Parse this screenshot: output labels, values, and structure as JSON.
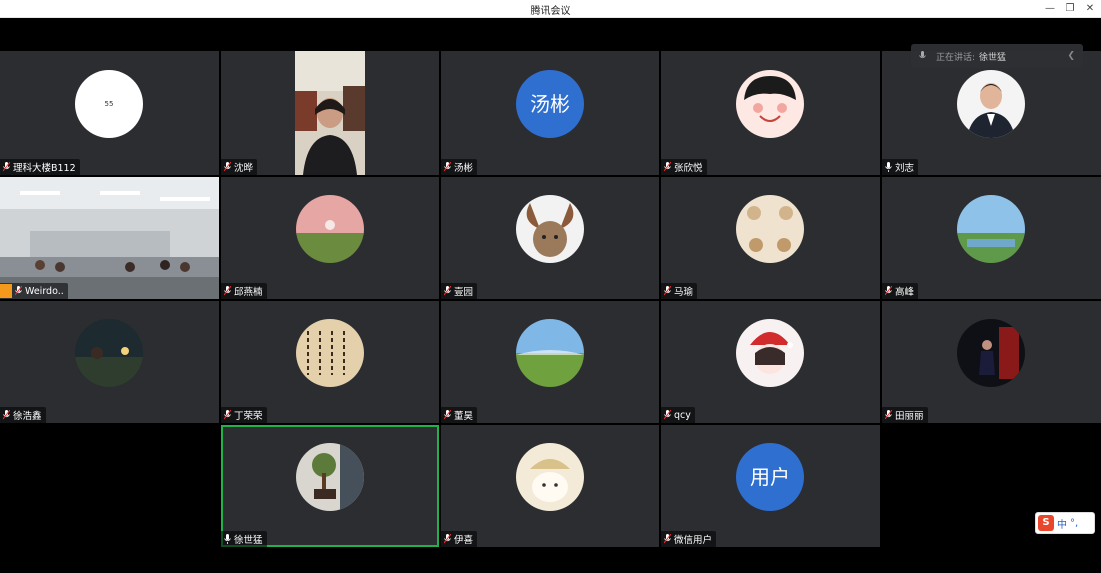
{
  "window": {
    "title": "腾讯会议",
    "controls": {
      "minimize": "—",
      "restore": "❐",
      "close": "✕"
    }
  },
  "speaking_banner": {
    "label": "正在讲话:",
    "speaker": "徐世猛"
  },
  "participants": [
    {
      "name": "理科大楼B112",
      "avatar_text": "55",
      "mic": "muted"
    },
    {
      "name": "沈晔",
      "avatar_text": "",
      "mic": "muted"
    },
    {
      "name": "汤彬",
      "avatar_text": "汤彬",
      "mic": "muted"
    },
    {
      "name": "张欣悦",
      "avatar_text": "",
      "mic": "muted"
    },
    {
      "name": "刘志",
      "avatar_text": "",
      "mic": "on"
    },
    {
      "name": "Weirdo..",
      "avatar_text": "",
      "mic": "muted"
    },
    {
      "name": "邱燕楠",
      "avatar_text": "",
      "mic": "muted"
    },
    {
      "name": "壹园",
      "avatar_text": "",
      "mic": "muted"
    },
    {
      "name": "马瑜",
      "avatar_text": "",
      "mic": "muted"
    },
    {
      "name": "高峰",
      "avatar_text": "",
      "mic": "muted"
    },
    {
      "name": "徐浩鑫",
      "avatar_text": "",
      "mic": "muted"
    },
    {
      "name": "丁荣荣",
      "avatar_text": "",
      "mic": "muted"
    },
    {
      "name": "董昊",
      "avatar_text": "",
      "mic": "muted"
    },
    {
      "name": "qcy",
      "avatar_text": "",
      "mic": "muted"
    },
    {
      "name": "田丽丽",
      "avatar_text": "",
      "mic": "muted"
    },
    {
      "name": "徐世猛",
      "avatar_text": "",
      "mic": "on"
    },
    {
      "name": "伊喜",
      "avatar_text": "",
      "mic": "muted"
    },
    {
      "name": "微信用户",
      "avatar_text": "用户",
      "mic": "muted"
    }
  ],
  "ime": {
    "logo": "S",
    "lang": "中",
    "punct": "°,"
  },
  "colors": {
    "active_border": "#22b24c",
    "tile_bg": "#2b2d31",
    "blue_avatar": "#2f6fd0"
  }
}
